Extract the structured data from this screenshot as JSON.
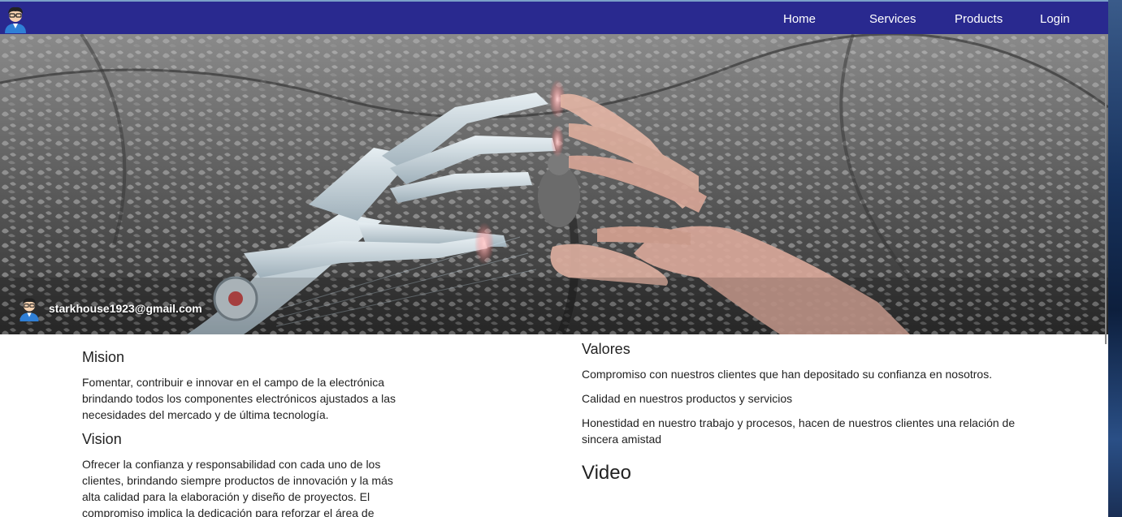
{
  "navbar": {
    "colors": {
      "background": "#29298f",
      "text": "#ffffff"
    },
    "logo_icon": "avatar-icon",
    "links": [
      {
        "label": "Home"
      },
      {
        "label": "Services"
      },
      {
        "label": "Products"
      },
      {
        "label": "Login"
      }
    ]
  },
  "hero": {
    "image": "robot-hand-reaching-human-hand-in-trees",
    "user_icon": "avatar-icon",
    "email": "starkhouse1923@gmail.com"
  },
  "mision": {
    "title": "Mision",
    "text": "Fomentar, contribuir e innovar en el campo de la electrónica brindando todos los componentes electrónicos ajustados a las necesidades del mercado y de última tecnología."
  },
  "vision": {
    "title": "Vision",
    "text": "Ofrecer la confianza y responsabilidad con cada uno de los clientes, brindando siempre productos de innovación y la más alta calidad para la elaboración y diseño de proyectos. El compromiso implica la dedicación para reforzar el área de"
  },
  "valores": {
    "title": "Valores",
    "items": [
      "Compromiso con nuestros clientes que han depositado su confianza en nosotros.",
      "Calidad en nuestros productos y servicios",
      "Honestidad en nuestro trabajo y procesos, hacen de nuestros clientes una relación de sincera amistad"
    ]
  },
  "video": {
    "title": "Video"
  }
}
